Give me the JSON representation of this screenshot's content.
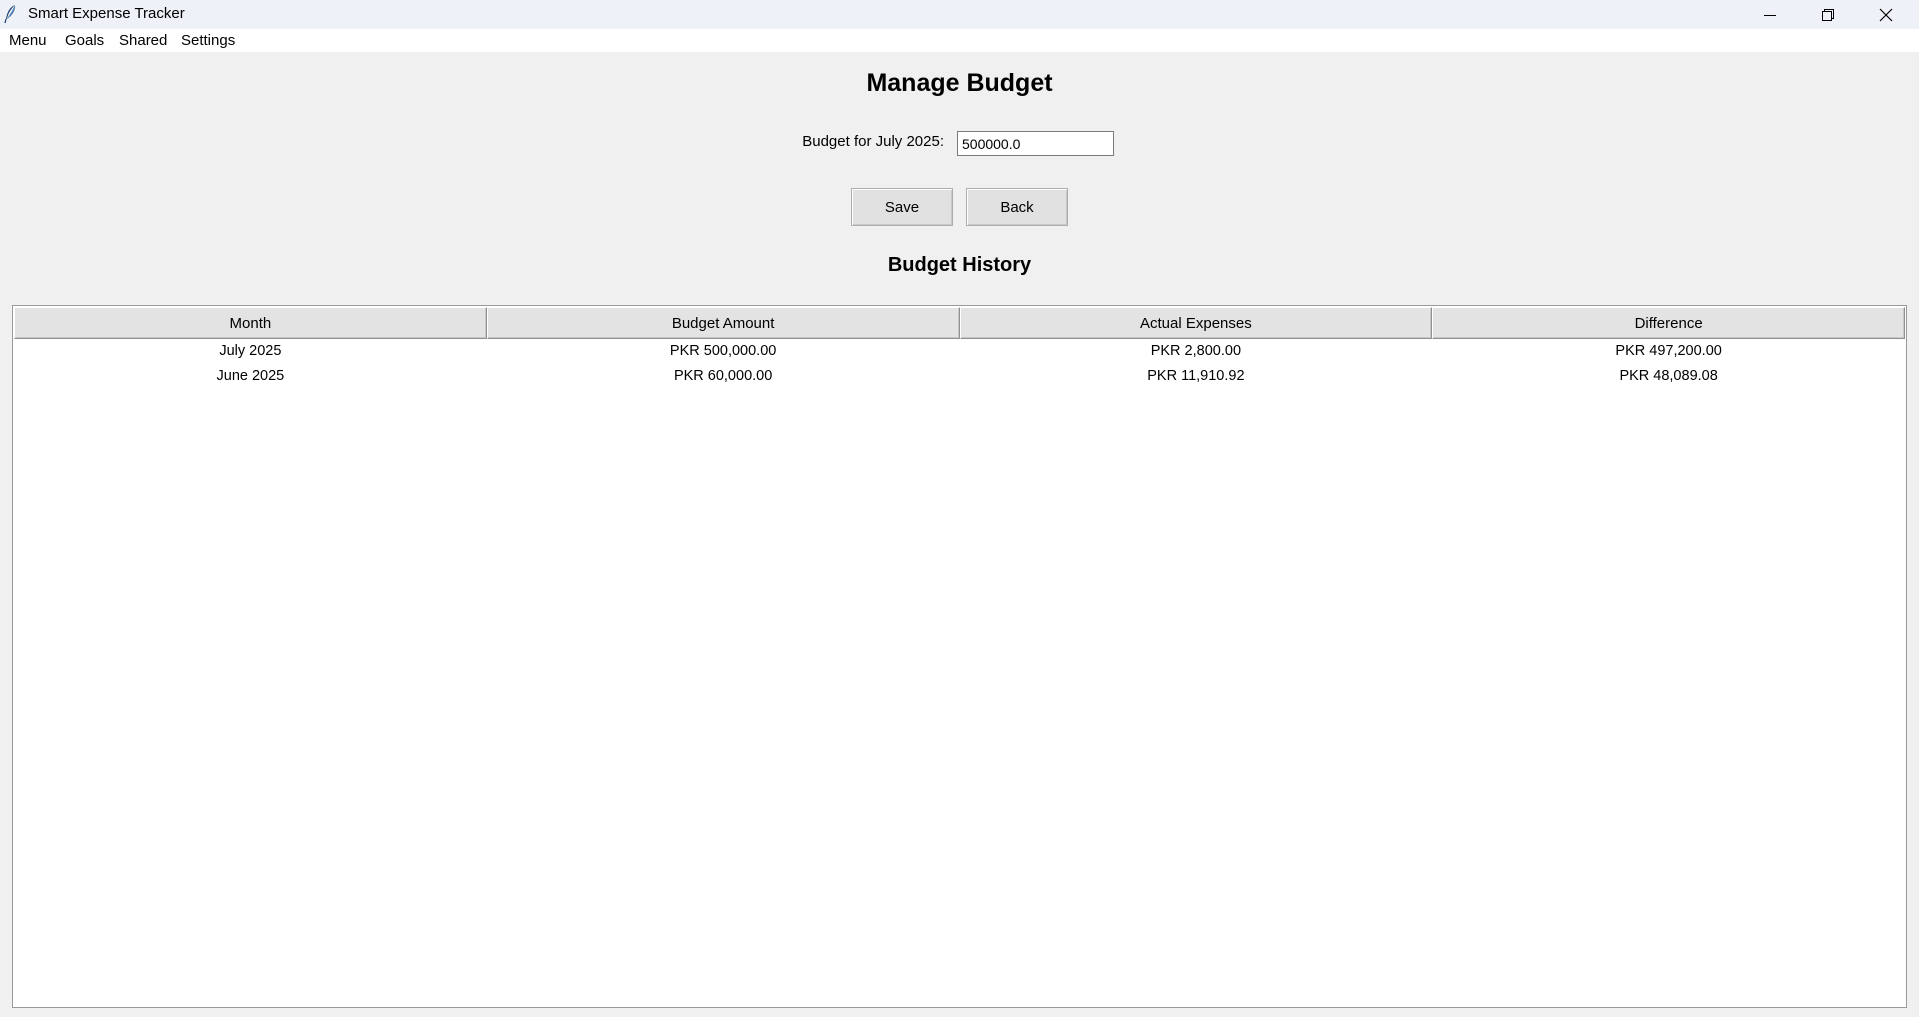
{
  "window": {
    "title": "Smart Expense Tracker",
    "icon": "feather-icon",
    "controls": [
      "minimize-icon",
      "restore-icon",
      "close-icon"
    ]
  },
  "menubar": {
    "items": [
      {
        "label": "Menu"
      },
      {
        "label": "Goals"
      },
      {
        "label": "Shared"
      },
      {
        "label": "Settings"
      }
    ]
  },
  "page": {
    "title": "Manage Budget",
    "budget_label": "Budget for July 2025:",
    "budget_value": "500000.0",
    "save_label": "Save",
    "back_label": "Back",
    "history_title": "Budget History"
  },
  "table": {
    "columns": [
      "Month",
      "Budget Amount",
      "Actual Expenses",
      "Difference"
    ],
    "rows": [
      [
        "July 2025",
        "PKR 500,000.00",
        "PKR 2,800.00",
        "PKR 497,200.00"
      ],
      [
        "June 2025",
        "PKR 60,000.00",
        "PKR 11,910.92",
        "PKR 48,089.08"
      ]
    ]
  }
}
